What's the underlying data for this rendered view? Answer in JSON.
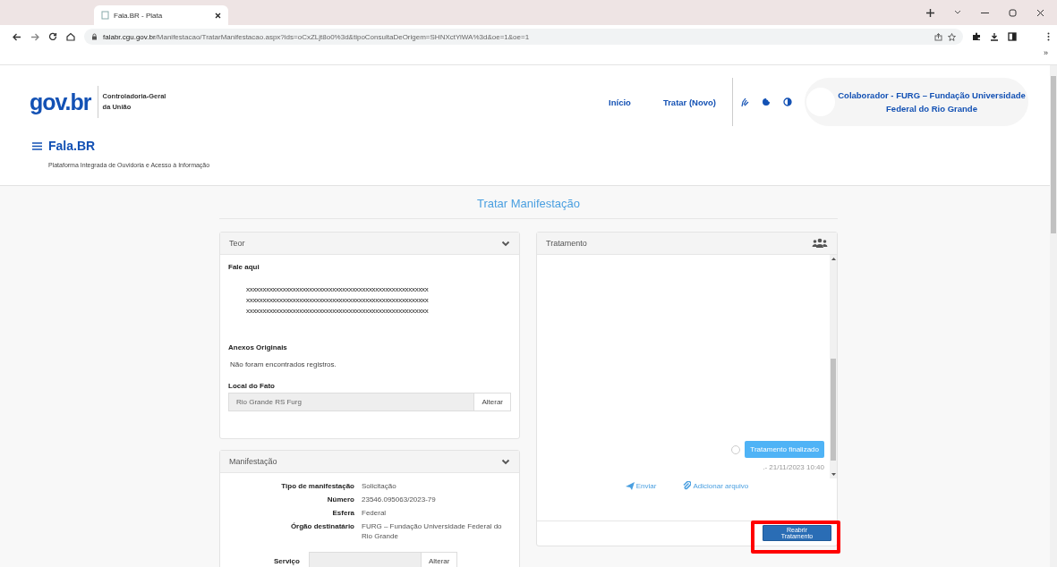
{
  "browser": {
    "tab_title": "Fala.BR - Plata",
    "url_host": "falabr.cgu.gov.br",
    "url_path": "/Manifestacao/TratarManifestacao.aspx?ids=oCxZLjt8o0%3d&tipoConsultaDeOrigem=SHNXctYiWA%3d&oe=1&oe=1",
    "overflow": "»"
  },
  "header": {
    "logo": "gov.br",
    "org_lines": [
      "Controladoria-Geral",
      "da União"
    ],
    "app_title": "Fala.BR",
    "app_subtitle": "Plataforma Integrada de Ouvidoria e Acesso à Informação",
    "nav": [
      {
        "label": "Início"
      },
      {
        "label": "Tratar (Novo)"
      }
    ],
    "user": "Colaborador - FURG – Fundação Universidade Federal do Rio Grande"
  },
  "page_title": "Tratar Manifestação",
  "teor": {
    "title": "Teor",
    "message_label": "Fale aqui",
    "message_lines": [
      "xxxxxxxxxxxxxxxxxxxxxxxxxxxxxxxxxxxxxxxxxxxxxxxxxxxxxxx",
      "xxxxxxxxxxxxxxxxxxxxxxxxxxxxxxxxxxxxxxxxxxxxxxxxxxxxxxx",
      "xxxxxxxxxxxxxxxxxxxxxxxxxxxxxxxxxxxxxxxxxxxxxxxxxxxxxxx"
    ],
    "attachments_label": "Anexos Originais",
    "attachments_empty": "Não foram encontrados registros.",
    "location_label": "Local do Fato",
    "location_value": "Rio Grande RS Furg",
    "location_button": "Alterar"
  },
  "manifestacao": {
    "title": "Manifestação",
    "fields": [
      {
        "label": "Tipo de manifestação",
        "value": "Solicitação"
      },
      {
        "label": "Número",
        "value": "23546.095063/2023-79"
      },
      {
        "label": "Esfera",
        "value": "Federal"
      },
      {
        "label": "Órgão destinatário",
        "value": "FURG – Fundação Universidade Federal do Rio Grande"
      }
    ],
    "service_label": "Serviço",
    "service_button": "Alterar"
  },
  "tratamento": {
    "title": "Tratamento",
    "messages": [
      {
        "text": "Tratamento finalizado",
        "meta": ".- 21/11/2023 10:40"
      }
    ],
    "actions": [
      {
        "label": "Enviar",
        "kind": "send"
      },
      {
        "label": "Adicionar arquivo",
        "kind": "attach"
      }
    ],
    "footer_button": "Reabrir Tratamento",
    "highlighted": true
  }
}
